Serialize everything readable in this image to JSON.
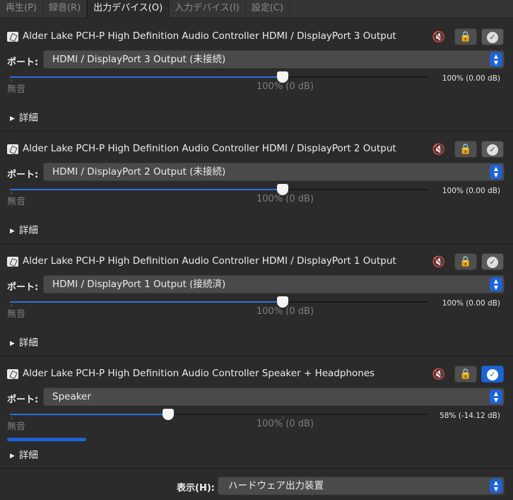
{
  "tabs": [
    "再生(P)",
    "録音(R)",
    "出力デバイス(O)",
    "入力デバイス(I)",
    "設定(C)"
  ],
  "active_tab": 2,
  "port_label": "ポート:",
  "mute_label": "無音",
  "base_label": "100% (0 dB)",
  "details_label": "詳細",
  "devices": [
    {
      "name": "Alder Lake PCH-P High Definition Audio Controller HDMI / DisplayPort 3 Output",
      "port": "HDMI / DisplayPort 3 Output (未接続)",
      "volume_percent": 100,
      "volume_readout": "100% (0.00 dB)",
      "is_default": false
    },
    {
      "name": "Alder Lake PCH-P High Definition Audio Controller HDMI / DisplayPort 2 Output",
      "port": "HDMI / DisplayPort 2 Output (未接続)",
      "volume_percent": 100,
      "volume_readout": "100% (0.00 dB)",
      "is_default": false
    },
    {
      "name": "Alder Lake PCH-P High Definition Audio Controller HDMI / DisplayPort 1 Output",
      "port": "HDMI / DisplayPort 1 Output (接続済)",
      "volume_percent": 100,
      "volume_readout": "100% (0.00 dB)",
      "is_default": false
    },
    {
      "name": "Alder Lake PCH-P High Definition Audio Controller Speaker + Headphones",
      "port": "Speaker",
      "volume_percent": 58,
      "volume_readout": "58% (-14.12 dB)",
      "is_default": true,
      "peak_level_percent": 19
    }
  ],
  "footer": {
    "label": "表示(H):",
    "value": "ハードウェア出力装置"
  },
  "icons": {
    "device": "speaker-device-icon",
    "mute": "speaker-mute-icon",
    "lock": "lock-icon",
    "default": "check-circle-icon",
    "dropdown": "dropdown-arrows-icon",
    "details": "disclosure-triangle-icon"
  },
  "colors": {
    "background": "#2b2b2b",
    "accent": "#1e63d6",
    "control": "#4a4a4a"
  }
}
